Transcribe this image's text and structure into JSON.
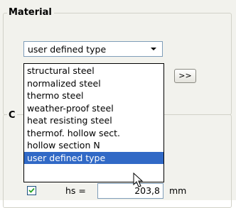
{
  "material_group": {
    "title": "Material",
    "combo_value": "user defined type",
    "more_button_label": ">>"
  },
  "dropdown": {
    "options": [
      "structural steel",
      "normalized steel",
      "thermo steel",
      "weather-proof steel",
      "heat resisting steel",
      "thermof. hollow sect.",
      "hollow section N",
      "user defined type"
    ],
    "selected_index": 7
  },
  "second_group": {
    "title_visible": "C"
  },
  "dimension_row": {
    "checked": true,
    "label": "hs =",
    "value": "203,8",
    "unit": "mm"
  },
  "colors": {
    "selection": "#3169c6",
    "panel_bg": "#f2f2ed",
    "combo_border": "#7f9db9"
  },
  "icons": {
    "combo_arrow": "chevron-down-icon",
    "checkbox_mark": "checkmark-icon",
    "pointer": "mouse-pointer-icon"
  }
}
